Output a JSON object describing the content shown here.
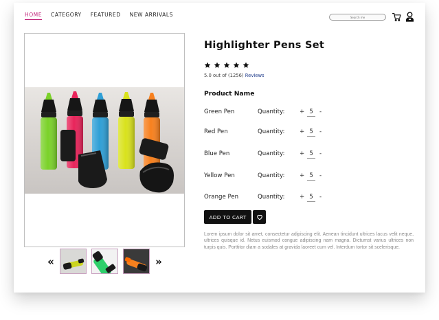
{
  "nav": {
    "items": [
      {
        "label": "HOME",
        "active": true
      },
      {
        "label": "CATEGORY",
        "active": false
      },
      {
        "label": "FEATURED",
        "active": false
      },
      {
        "label": "NEW ARRIVALS",
        "active": false
      }
    ]
  },
  "search": {
    "placeholder": "Search me"
  },
  "icons": {
    "cart": "cart-icon",
    "user": "user-icon",
    "heart": "heart-icon",
    "star": "star-icon",
    "prev": "chevron-double-left-icon",
    "next": "chevron-double-right-icon"
  },
  "product": {
    "title": "Highlighter Pens Set",
    "stars": 5,
    "rating_text": "5.0 out of (1256)",
    "reviews_link": "Reviews",
    "list_heading": "Product Name",
    "quantity_label": "Quantity:",
    "plus": "+",
    "minus": "-",
    "items": [
      {
        "name": "Green Pen",
        "qty": "5"
      },
      {
        "name": "Red Pen",
        "qty": "5"
      },
      {
        "name": "Blue Pen",
        "qty": "5"
      },
      {
        "name": "Yellow Pen",
        "qty": "5"
      },
      {
        "name": "Orange Pen",
        "qty": "5"
      }
    ],
    "add_to_cart": "ADD TO CART",
    "description": "Lorem ipsum dolor sit amet, consectetur adipiscing elit. Aenean tincidunt ultrices lacus velit neque, ultrices quisque id. Netus euismod congue adipiscing nam magna. Dictumst varius ultrices non turpis quis. Porttitor diam a sodales at gravida laoreet cum vel. Interdum tortor sit scelerisque."
  },
  "gallery": {
    "prev": "«",
    "next": "»",
    "pen_colors": [
      "#7bd22a",
      "#e8245a",
      "#2f9fd6",
      "#d9e21c",
      "#f7801e"
    ],
    "accent": "#c0247a"
  }
}
